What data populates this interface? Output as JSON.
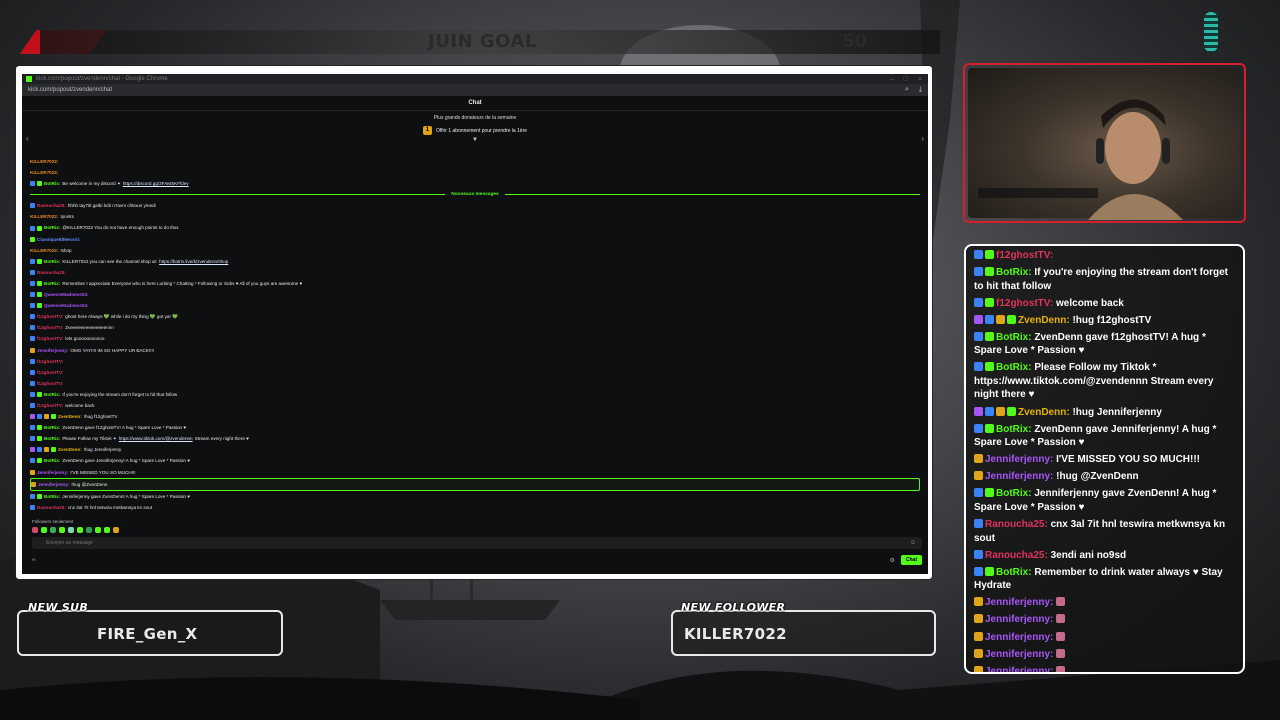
{
  "goal": {
    "title": "JUIN GOAL",
    "count": "50"
  },
  "browser": {
    "title_text": "kick.com/popout/zvendenn/chat - Google Chrome",
    "url": "kick.com/popout/zvendenn/chat"
  },
  "kick_chat": {
    "header": "Chat",
    "donors_title": "Plus grands donateurs de la semaine",
    "rank": "1",
    "donors_cta": "Offrir 1 abonnement pour prendre la 1ère",
    "divider_label": "Nouveaux messages",
    "pre_messages": [
      {
        "user": "KILLER7022:",
        "color": "orange",
        "text": "",
        "icons": []
      },
      {
        "user": "KILLER7022:",
        "color": "orange",
        "text": "",
        "icons": []
      },
      {
        "user": "BotRix:",
        "color": "green",
        "text": "Be welcome in my discord ✦",
        "link": "https://discord.gg/3FAMSKFfdev",
        "icons": [
          "mod",
          "green"
        ]
      }
    ],
    "messages": [
      {
        "user": "Ranoucha25:",
        "color": "red",
        "text": "hhhh tay7itl galbi bdit n7avm chkoun ymedi",
        "icons": [
          "mod"
        ]
      },
      {
        "user": "KILLER7022:",
        "color": "orange",
        "text": "!points",
        "icons": []
      },
      {
        "user": "BotRix:",
        "color": "green",
        "text": "@KILLER7022 You do not have enough points to do that.",
        "icons": [
          "mod",
          "green"
        ]
      },
      {
        "user": "ClassiqueElMessiri:",
        "color": "blue",
        "text": "",
        "icons": [
          "green"
        ]
      },
      {
        "user": "KILLER7022:",
        "color": "orange",
        "text": "!shop",
        "icons": []
      },
      {
        "user": "BotRix:",
        "color": "green",
        "text": "KILLER7022 you can see the channel shop at:",
        "link": "https://botrix.live/k/zvendenn/shop",
        "icons": [
          "mod",
          "green"
        ]
      },
      {
        "user": "Ranoucha25:",
        "color": "red",
        "text": "",
        "icons": [
          "mod"
        ]
      },
      {
        "user": "BotRix:",
        "color": "green",
        "text": "Remember I appreciate Everyone who is here Lurking * Chatting * Following or Subs ♥ All of you guys are awesome ♥",
        "icons": [
          "mod",
          "green"
        ]
      },
      {
        "user": "QueenieMadness04:",
        "color": "violet",
        "text": "",
        "icons": [
          "mod",
          "green"
        ]
      },
      {
        "user": "QueenieMadness04:",
        "color": "violet",
        "text": "",
        "icons": [
          "mod",
          "green"
        ]
      },
      {
        "user": "f12ghostTV:",
        "color": "red",
        "text": "ghost here Always 💚 while i do my thing 💚 got ya! 💚",
        "icons": [
          "mod"
        ]
      },
      {
        "user": "f12ghostTV:",
        "color": "red",
        "text": "Zveeeeeeeeeeeeeennn",
        "icons": [
          "mod"
        ]
      },
      {
        "user": "f12ghostTV:",
        "color": "red",
        "text": "lets gooooooooooo",
        "icons": [
          "mod"
        ]
      },
      {
        "user": "Jenniferjenny:",
        "color": "violet",
        "text": "OMG YAY!!!! IM SO HAPPY UR BACK!!!!",
        "icons": [
          "gold"
        ]
      },
      {
        "user": "f12ghostTV:",
        "color": "red",
        "text": "",
        "icons": [
          "mod"
        ]
      },
      {
        "user": "f12ghostTV:",
        "color": "red",
        "text": "",
        "icons": [
          "mod"
        ]
      },
      {
        "user": "f12ghostTV:",
        "color": "red",
        "text": "",
        "icons": [
          "mod"
        ]
      },
      {
        "user": "BotRix:",
        "color": "green",
        "text": "If you're enjoying the stream don't forget to hit that follow",
        "icons": [
          "mod",
          "green"
        ]
      },
      {
        "user": "f12ghostTV:",
        "color": "red",
        "text": "welcome back",
        "icons": [
          "mod"
        ]
      },
      {
        "user": "ZvenDenn:",
        "color": "gold",
        "text": "!hug f12ghostTV",
        "icons": [
          "purple",
          "mod",
          "gold",
          "green"
        ]
      },
      {
        "user": "BotRix:",
        "color": "green",
        "text": "ZvenDenn gave f12ghostTV! A hug * Spare Love * Passion ♥",
        "icons": [
          "mod",
          "green"
        ]
      },
      {
        "user": "BotRix:",
        "color": "green",
        "text": "Please Follow my Tiktok ✦",
        "link": "https://www.tiktok.com/@zvendennn",
        "text_after": "Stream every night there ♥",
        "icons": [
          "mod",
          "green"
        ]
      },
      {
        "user": "ZvenDenn:",
        "color": "gold",
        "text": "!hug Jenniferjenny",
        "icons": [
          "purple",
          "mod",
          "gold",
          "green"
        ]
      },
      {
        "user": "BotRix:",
        "color": "green",
        "text": "ZvenDenn gave Jenniferjenny! A hug * Spare Love * Passion ♥",
        "icons": [
          "mod",
          "green"
        ]
      },
      {
        "user": "Jenniferjenny:",
        "color": "violet",
        "text": "I'VE MISSED YOU SO MUCH!!!",
        "icons": [
          "gold"
        ]
      },
      {
        "user": "Jenniferjenny:",
        "color": "violet",
        "text": "!hug @ZvenDenn",
        "icons": [
          "gold"
        ],
        "highlight": true
      },
      {
        "user": "BotRix:",
        "color": "green",
        "text": "Jenniferjenny gave ZvenDenn! A hug * Spare Love * Passion ♥",
        "icons": [
          "mod",
          "green"
        ]
      },
      {
        "user": "Ranoucha25:",
        "color": "red",
        "text": "cnx 3al 7it hnl teswira metkwnsya kn sout",
        "icons": [
          "mod"
        ]
      }
    ],
    "followers_only": "Followers seulement",
    "input_placeholder": "Envoyer un message",
    "send_label": "Chat",
    "bottom_left": "∞"
  },
  "overlay_chat": [
    {
      "user": "f12ghostTV:",
      "color": "red",
      "text": "",
      "icons": [
        "mod",
        "green"
      ]
    },
    {
      "user": "BotRix:",
      "color": "green",
      "text": "If you're enjoying the stream don't forget to hit that follow",
      "icons": [
        "mod",
        "green"
      ]
    },
    {
      "user": "f12ghostTV:",
      "color": "red",
      "text": "welcome back",
      "icons": [
        "mod",
        "green"
      ]
    },
    {
      "user": "ZvenDenn:",
      "color": "gold",
      "text": "!hug f12ghostTV",
      "icons": [
        "purple",
        "mod",
        "gold",
        "green"
      ]
    },
    {
      "user": "BotRix:",
      "color": "green",
      "text": "ZvenDenn gave f12ghostTV! A hug * Spare Love * Passion ♥",
      "icons": [
        "mod",
        "green"
      ]
    },
    {
      "user": "BotRix:",
      "color": "green",
      "text": "Please Follow my Tiktok * https://www.tiktok.com/@zvendennn Stream every night there ♥",
      "icons": [
        "mod",
        "green"
      ]
    },
    {
      "user": "ZvenDenn:",
      "color": "gold",
      "text": "!hug Jenniferjenny",
      "icons": [
        "purple",
        "mod",
        "gold",
        "green"
      ]
    },
    {
      "user": "BotRix:",
      "color": "green",
      "text": "ZvenDenn gave Jenniferjenny! A hug * Spare Love * Passion ♥",
      "icons": [
        "mod",
        "green"
      ]
    },
    {
      "user": "Jenniferjenny:",
      "color": "violet",
      "text": "I'VE MISSED YOU SO MUCH!!!",
      "icons": [
        "gold"
      ]
    },
    {
      "user": "Jenniferjenny:",
      "color": "violet",
      "text": "!hug @ZvenDenn",
      "icons": [
        "gold"
      ]
    },
    {
      "user": "BotRix:",
      "color": "green",
      "text": "Jenniferjenny gave ZvenDenn! A hug * Spare Love * Passion ♥",
      "icons": [
        "mod",
        "green"
      ]
    },
    {
      "user": "Ranoucha25:",
      "color": "red",
      "text": "cnx 3al 7it hnl teswira metkwnsya kn sout",
      "icons": [
        "mod"
      ]
    },
    {
      "user": "Ranoucha25:",
      "color": "red",
      "text": "3endi ani no9sd",
      "icons": [
        "mod"
      ]
    },
    {
      "user": "BotRix:",
      "color": "green",
      "text": "Remember to drink water always ♥ Stay Hydrate",
      "icons": [
        "mod",
        "green"
      ]
    },
    {
      "user": "Jenniferjenny:",
      "color": "violet",
      "text": "",
      "emote": true,
      "icons": [
        "gold"
      ]
    },
    {
      "user": "Jenniferjenny:",
      "color": "violet",
      "text": "",
      "emote": true,
      "icons": [
        "gold"
      ]
    },
    {
      "user": "Jenniferjenny:",
      "color": "violet",
      "text": "",
      "emote": true,
      "icons": [
        "gold"
      ]
    },
    {
      "user": "Jenniferjenny:",
      "color": "violet",
      "text": "",
      "emote": true,
      "icons": [
        "gold"
      ]
    },
    {
      "user": "Jenniferjenny:",
      "color": "violet",
      "text": "",
      "emote": true,
      "icons": [
        "gold"
      ]
    }
  ],
  "alerts": {
    "new_sub": {
      "label": "NEW SUB",
      "name": "FIRE_Gen_X"
    },
    "new_follower": {
      "label": "NEW FOLLOWER",
      "name": "KILLER7022"
    }
  },
  "colors": {
    "kick_green": "#53fc18",
    "webcam_border": "#d61f2c",
    "accent_red": "#c0111b"
  }
}
